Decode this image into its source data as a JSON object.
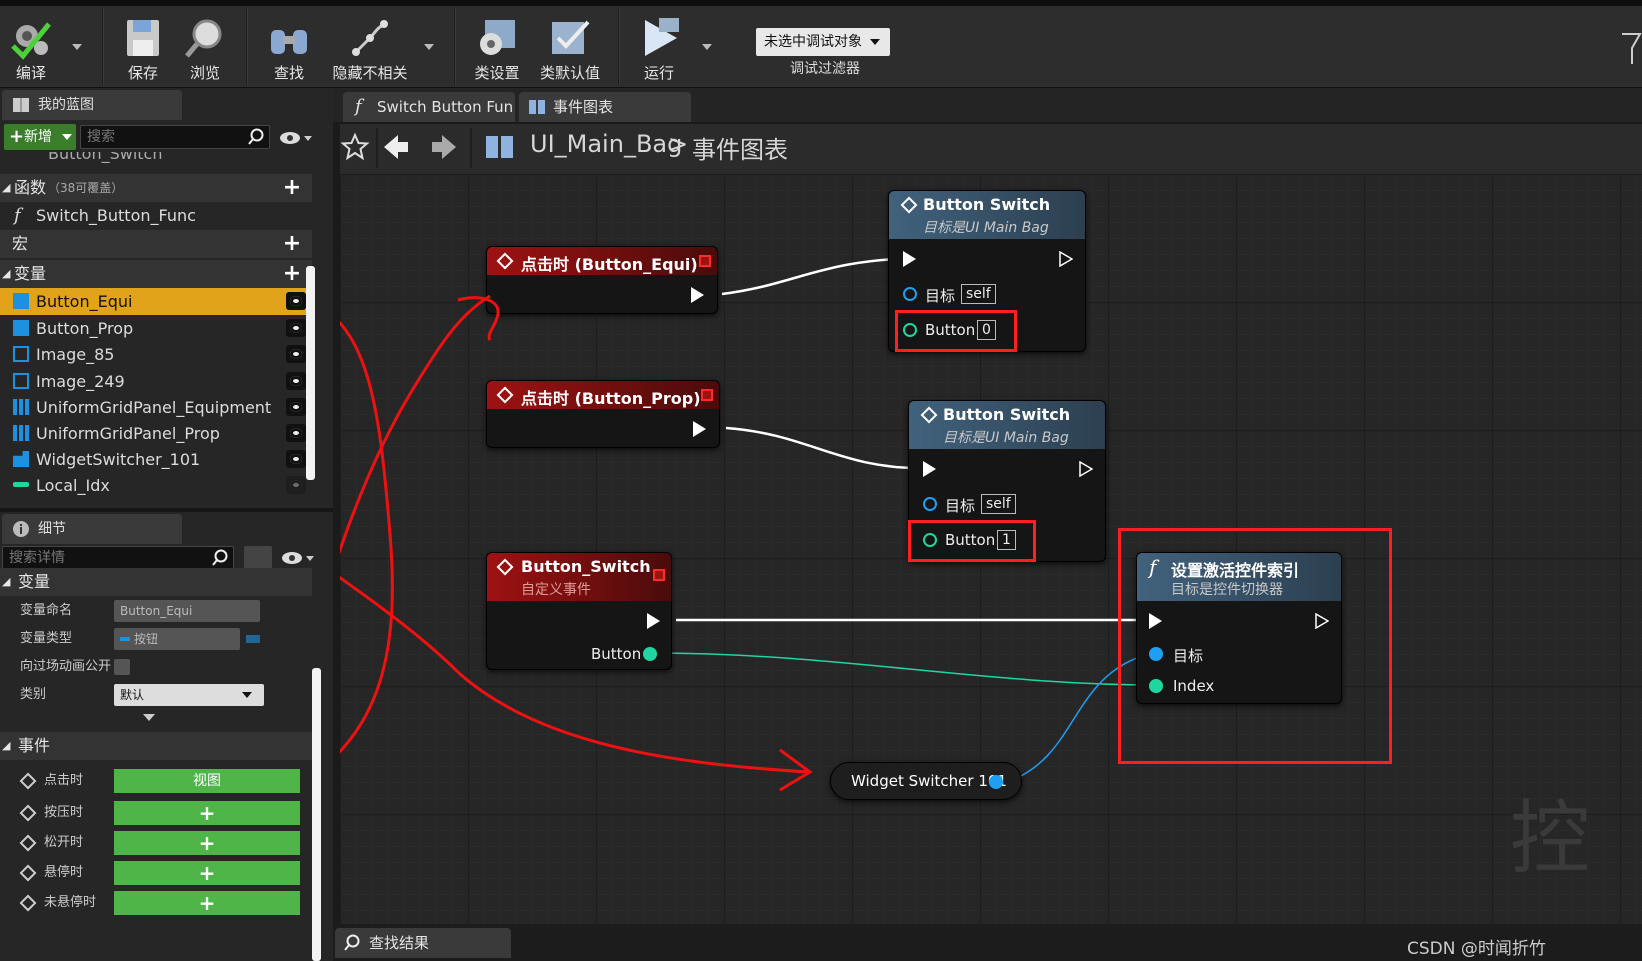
{
  "toolbar": {
    "compile": "编译",
    "save": "保存",
    "browse": "浏览",
    "find": "查找",
    "hide_unrelated": "隐藏不相关",
    "class_settings": "类设置",
    "class_defaults": "类默认值",
    "play": "运行",
    "debug_select": "未选中调试对象",
    "debug_filter": "调试过滤器"
  },
  "my_blueprint": {
    "tab": "我的蓝图",
    "new_button": "新增",
    "search_placeholder": "搜索",
    "partial_item": "Button_Switch",
    "functions_label": "函数",
    "functions_override": "（38可覆盖）",
    "function_item": "Switch_Button_Func",
    "macros_label": "宏",
    "variables_label": "变量",
    "variables": [
      {
        "name": "Button_Equi",
        "icon": "button-widget-icon"
      },
      {
        "name": "Button_Prop",
        "icon": "button-widget-icon"
      },
      {
        "name": "Image_85",
        "icon": "image-widget-icon"
      },
      {
        "name": "Image_249",
        "icon": "image-widget-icon"
      },
      {
        "name": "UniformGridPanel_Equipment",
        "icon": "grid-panel-icon"
      },
      {
        "name": "UniformGridPanel_Prop",
        "icon": "grid-panel-icon"
      },
      {
        "name": "WidgetSwitcher_101",
        "icon": "widget-switcher-icon"
      },
      {
        "name": "Local_Idx",
        "icon": "integer-var-icon"
      }
    ]
  },
  "details": {
    "tab": "细节",
    "search_placeholder": "搜索详情",
    "variable_section": "变量",
    "var_name_label": "变量命名",
    "var_name_value": "Button_Equi",
    "var_type_label": "变量类型",
    "var_type_value": "按钮",
    "expose_label": "向过场动画公开",
    "category_label": "类别",
    "category_value": "默认",
    "events_section": "事件",
    "events": [
      {
        "label": "点击时",
        "button": "视图"
      },
      {
        "label": "按压时",
        "button": "+"
      },
      {
        "label": "松开时",
        "button": "+"
      },
      {
        "label": "悬停时",
        "button": "+"
      },
      {
        "label": "未悬停时",
        "button": "+"
      }
    ]
  },
  "graph_tabs": {
    "tab1": "Switch Button Fun",
    "tab2": "事件图表"
  },
  "breadcrumb": {
    "blueprint": "UI_Main_Bag",
    "separator": ">",
    "graph": "事件图表"
  },
  "nodes": {
    "event_equi": {
      "title": "点击时 (Button_Equi)"
    },
    "event_prop": {
      "title": "点击时 (Button_Prop)"
    },
    "custom_event": {
      "title": "Button_Switch",
      "subtitle": "自定义事件",
      "pin": "Button"
    },
    "call1": {
      "title": "Button Switch",
      "subtitle": "目标是UI Main Bag",
      "target_label": "目标",
      "target_value": "self",
      "button_label": "Button",
      "button_value": "0"
    },
    "call2": {
      "title": "Button Switch",
      "subtitle": "目标是UI Main Bag",
      "target_label": "目标",
      "target_value": "self",
      "button_label": "Button",
      "button_value": "1"
    },
    "set_index": {
      "title": "设置激活控件索引",
      "subtitle": "目标是控件切换器",
      "target_label": "目标",
      "index_label": "Index"
    },
    "widget_var": {
      "title": "Widget Switcher 101"
    }
  },
  "bottom_tab": "查找结果",
  "watermark": "CSDN @时闻折竹",
  "graph_corner_text": "控",
  "colors": {
    "accent_selected": "#e0a31a",
    "event_node_red": "#9e1212",
    "function_node_blue": "#41627d",
    "exec_wire": "#ffffff",
    "int_pin": "#1fd6a0",
    "object_pin": "#1e9ff2",
    "annotation_red": "#ff1f1f",
    "add_green": "#4fb548"
  }
}
